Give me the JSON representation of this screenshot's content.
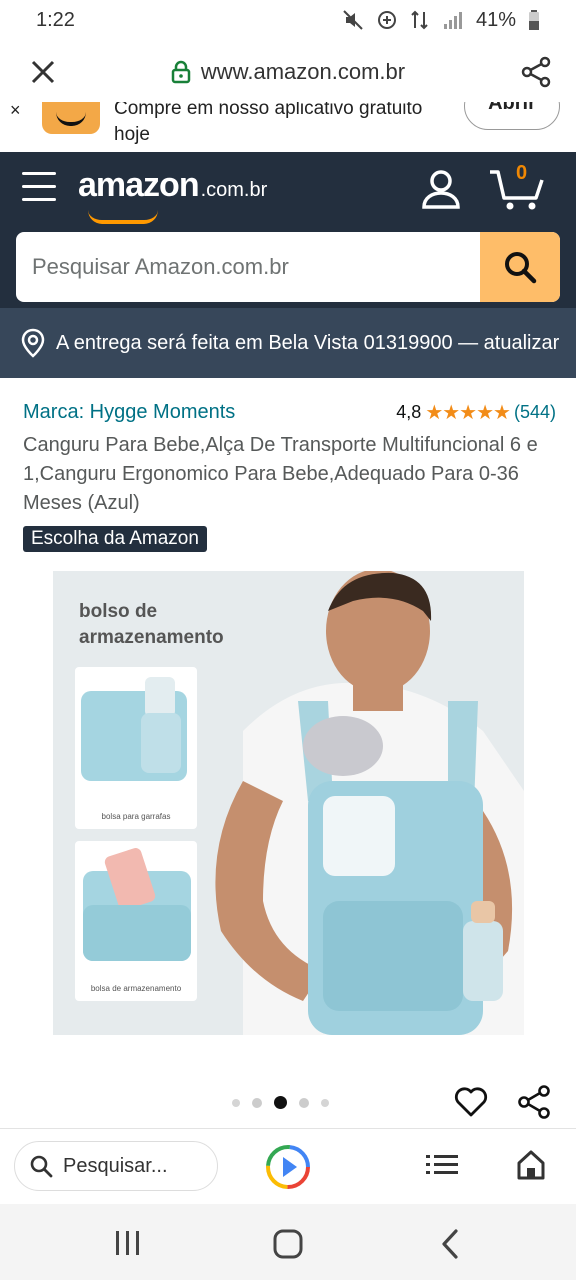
{
  "status_bar": {
    "time": "1:22",
    "battery": "41%"
  },
  "browser": {
    "url": "www.amazon.com.br"
  },
  "promo": {
    "close": "×",
    "text": "Compre em nosso aplicativo gratuito hoje",
    "open_label": "Abrir"
  },
  "header": {
    "logo_word": "amazon",
    "logo_tld": ".com.br",
    "cart_count": "0",
    "search_placeholder": "Pesquisar Amazon.com.br"
  },
  "delivery": {
    "text": "A entrega será feita em Bela Vista 01319900 — atualizar"
  },
  "product": {
    "brand": "Marca: Hygge Moments",
    "rating": "4,8",
    "stars": "★★★★★",
    "review_count": "(544)",
    "title": "Canguru Para Bebe,Alça De Transporte Multifuncional 6 e 1,Canguru Ergonomico Para Bebe,Adequado Para 0-36 Meses (Azul)",
    "badge": "Escolha da Amazon"
  },
  "image": {
    "caption_line1": "bolso de",
    "caption_line2": "armazenamento",
    "card1_label": "bolsa para garrafas",
    "card2_label": "bolsa de armazenamento"
  },
  "carousel": {
    "total": 5,
    "active_index": 2
  },
  "bottom_toolbar": {
    "search_label": "Pesquisar..."
  },
  "colors": {
    "header_bg": "#232f3e",
    "delivery_bg": "#37475a",
    "search_btn": "#febd69",
    "link": "#007185",
    "stars": "#f28c18"
  }
}
